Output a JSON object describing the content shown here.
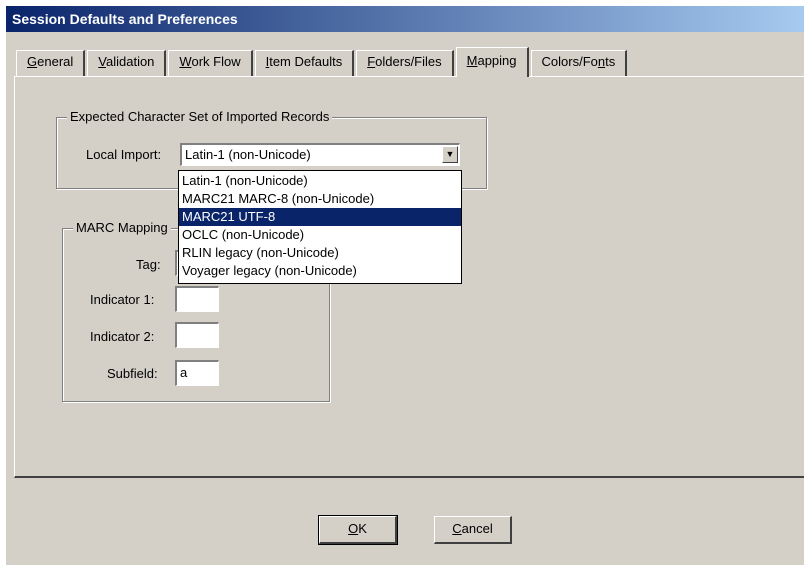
{
  "window": {
    "title": "Session Defaults and Preferences"
  },
  "tabs": [
    {
      "label": "General",
      "accesskey": "G",
      "rest": "eneral",
      "active": false
    },
    {
      "label": "Validation",
      "accesskey": "V",
      "rest": "alidation",
      "active": false
    },
    {
      "label": "Work Flow",
      "accesskey": "W",
      "rest": "ork Flow",
      "active": false
    },
    {
      "label": "Item Defaults",
      "accesskey": "I",
      "rest": "tem Defaults",
      "active": false
    },
    {
      "label": "Folders/Files",
      "accesskey": "F",
      "rest": "olders/Files",
      "active": false
    },
    {
      "label": "Mapping",
      "accesskey": "M",
      "rest": "apping",
      "active": true
    },
    {
      "label": "Colors/Fonts",
      "pre": "Colors/Fo",
      "accesskey": "n",
      "rest": "ts",
      "active": false
    }
  ],
  "charset_group": {
    "legend": "Expected Character Set of Imported Records",
    "local_import_label": "Local Import:",
    "local_import_value": "Latin-1 (non-Unicode)",
    "options": [
      "Latin-1 (non-Unicode)",
      "MARC21 MARC-8 (non-Unicode)",
      "MARC21 UTF-8",
      "OCLC (non-Unicode)",
      "RLIN legacy (non-Unicode)",
      "Voyager legacy (non-Unicode)"
    ],
    "highlighted_index": 2
  },
  "marc_group": {
    "legend": "MARC Mapping",
    "tag_label": "Tag:",
    "tag_value": "",
    "indicator1_label": "Indicator 1:",
    "indicator1_value": "",
    "indicator2_label": "Indicator 2:",
    "indicator2_value": "",
    "subfield_label": "Subfield:",
    "subfield_value": "a"
  },
  "buttons": {
    "ok_accesskey": "O",
    "ok_rest": "K",
    "cancel_accesskey": "C",
    "cancel_rest": "ancel"
  }
}
